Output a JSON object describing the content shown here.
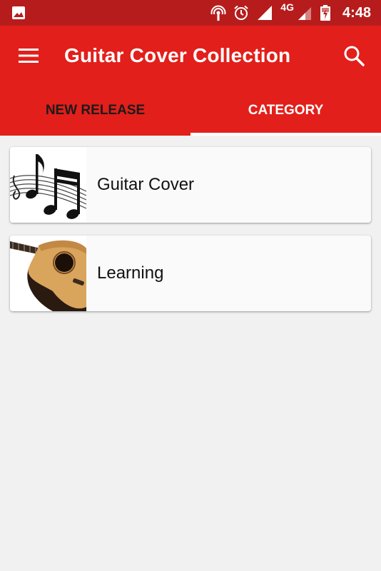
{
  "status_bar": {
    "network": "4G",
    "time": "4:48"
  },
  "app_bar": {
    "title": "Guitar Cover Collection",
    "menu_icon": "hamburger-menu-icon",
    "search_icon": "search-icon"
  },
  "tabs": [
    {
      "label": "NEW RELEASE",
      "active": false
    },
    {
      "label": "CATEGORY",
      "active": true
    }
  ],
  "categories": [
    {
      "label": "Guitar Cover",
      "thumbnail": "music-notes-image"
    },
    {
      "label": "Learning",
      "thumbnail": "acoustic-guitar-image"
    }
  ],
  "colors": {
    "status_bar": "#b71c1c",
    "primary": "#e21f1a",
    "background": "#f1f1f1",
    "card": "#fafafa"
  }
}
